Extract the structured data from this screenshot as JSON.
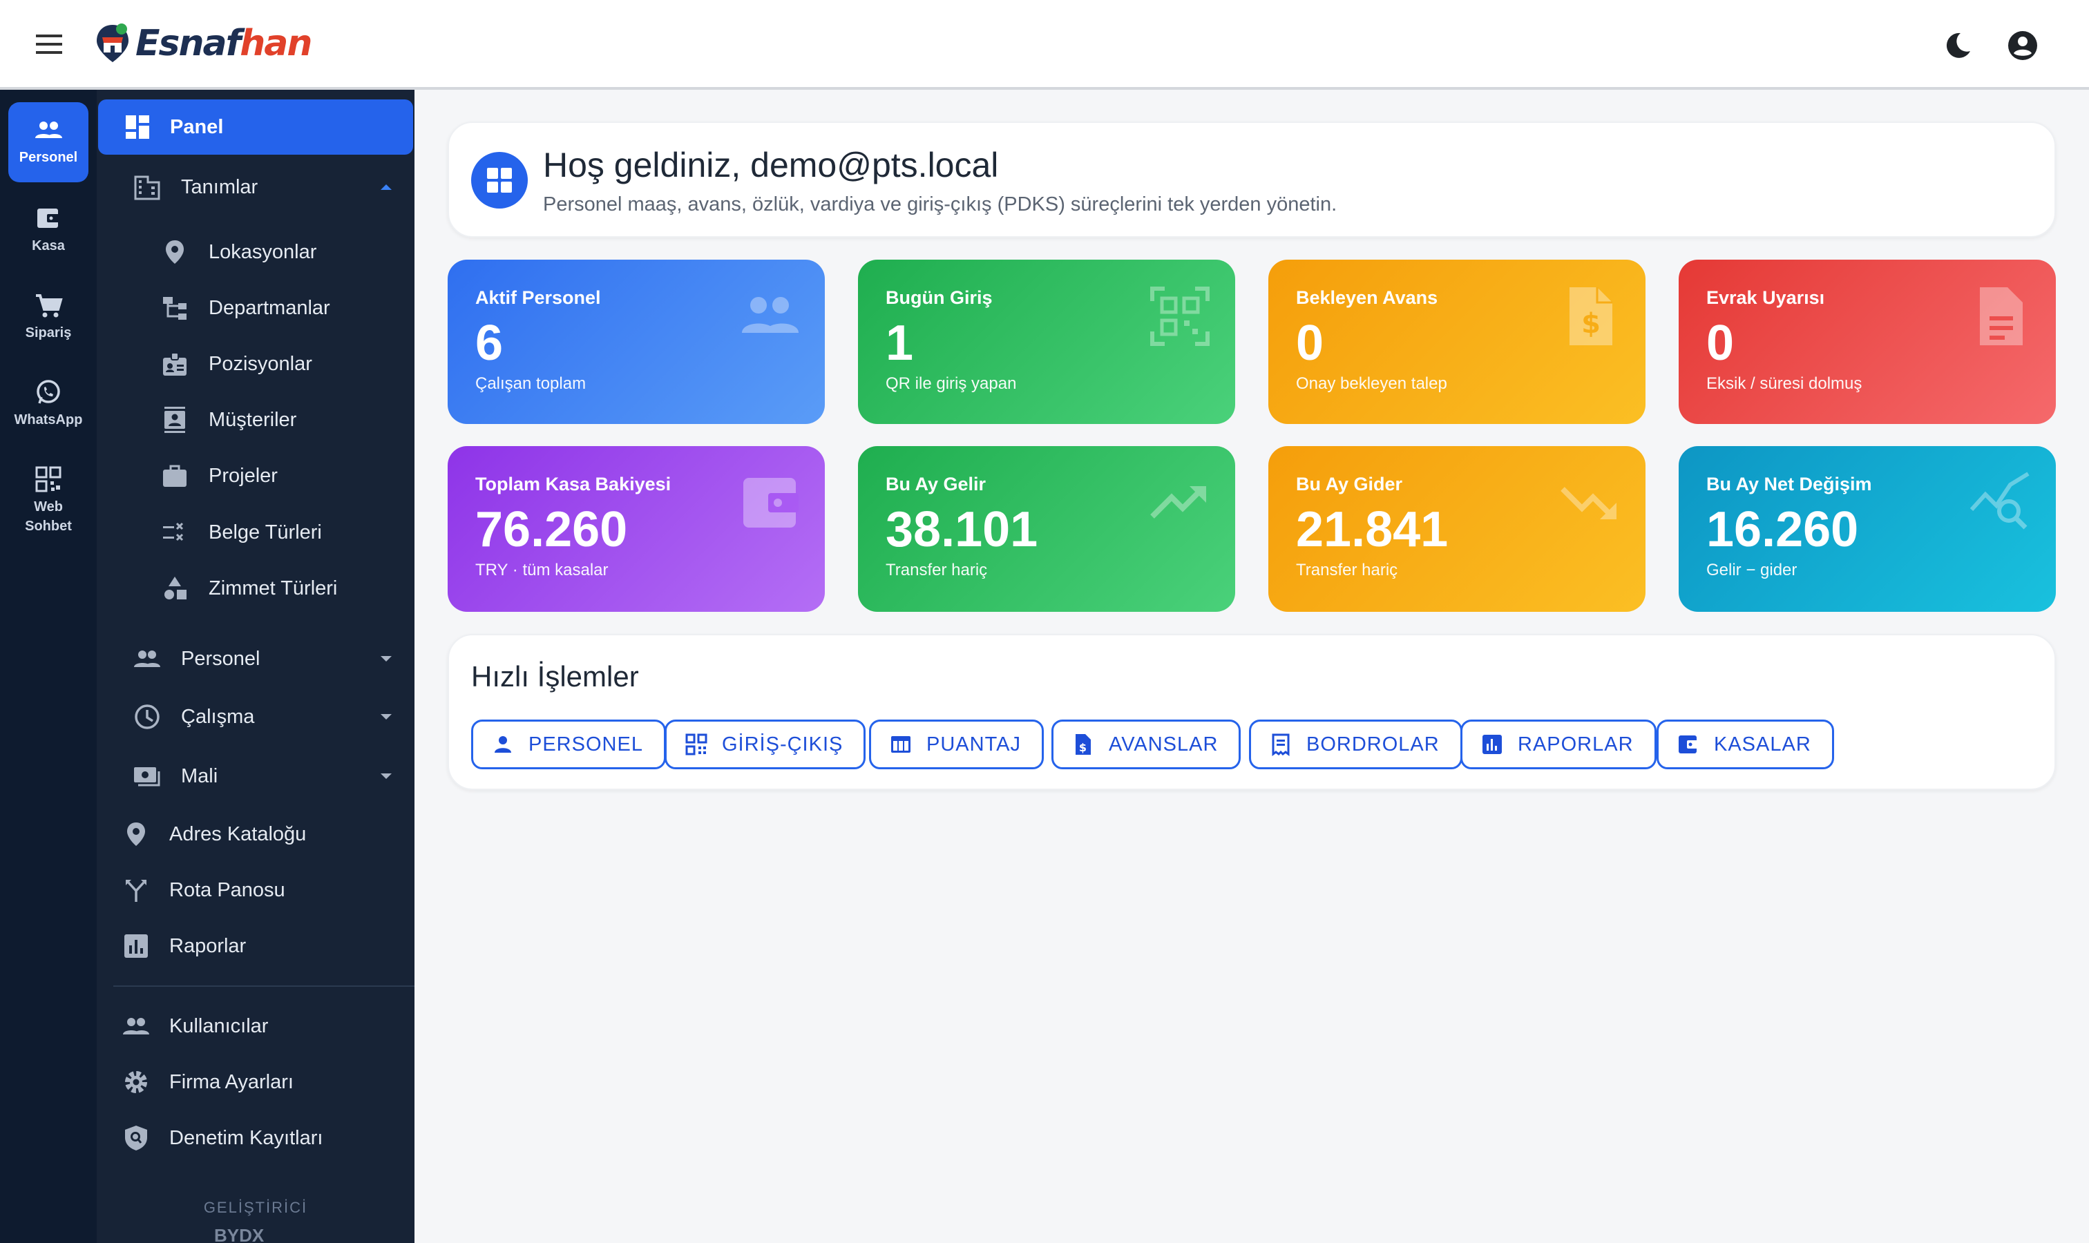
{
  "brand": {
    "name_part1": "Esnaf",
    "name_part2": "han",
    "icon": "store-pin-logo"
  },
  "topbar": {
    "menu_icon": "hamburger-icon",
    "theme_icon": "moon-icon",
    "account_icon": "account-circle-icon"
  },
  "rail": {
    "items": [
      {
        "label": "Personel",
        "icon": "people-icon",
        "active": true
      },
      {
        "label": "Kasa",
        "icon": "wallet-icon"
      },
      {
        "label": "Sipariş",
        "icon": "cart-icon"
      },
      {
        "label": "WhatsApp",
        "icon": "whatsapp-icon"
      },
      {
        "label": "Web Sohbet",
        "icon": "qr-chat-icon"
      }
    ]
  },
  "sidebar": {
    "panel": "Panel",
    "tanimlar": "Tanımlar",
    "sub_items": [
      "Lokasyonlar",
      "Departmanlar",
      "Pozisyonlar",
      "Müşteriler",
      "Projeler",
      "Belge Türleri",
      "Zimmet Türleri"
    ],
    "groups": [
      "Personel",
      "Çalışma",
      "Mali"
    ],
    "links": [
      "Adres Kataloğu",
      "Rota Panosu",
      "Raporlar"
    ],
    "admin": [
      "Kullanıcılar",
      "Firma Ayarları",
      "Denetim Kayıtları"
    ],
    "developer_label": "GELİŞTİRİCİ",
    "developer_logo": "BYDX"
  },
  "welcome": {
    "title": "Hoş geldiniz, demo@pts.local",
    "subtitle": "Personel maaş, avans, özlük, vardiya ve giriş-çıkış (PDKS) süreçlerini tek yerden yönetin."
  },
  "stats": [
    {
      "title": "Aktif Personel",
      "value": "6",
      "sub": "Çalışan toplam",
      "icon": "people-icon",
      "color": "#3b82f6"
    },
    {
      "title": "Bugün Giriş",
      "value": "1",
      "sub": "QR ile giriş yapan",
      "icon": "qr-code-icon",
      "color": "#22c55e"
    },
    {
      "title": "Bekleyen Avans",
      "value": "0",
      "sub": "Onay bekleyen talep",
      "icon": "money-file-icon",
      "color": "#f59e0b"
    },
    {
      "title": "Evrak Uyarısı",
      "value": "0",
      "sub": "Eksik / süresi dolmuş",
      "icon": "document-icon",
      "color": "#ef4444"
    },
    {
      "title": "Toplam Kasa Bakiyesi",
      "value": "76.260",
      "sub": "TRY · tüm kasalar",
      "icon": "wallet-icon",
      "color": "#a855f7"
    },
    {
      "title": "Bu Ay Gelir",
      "value": "38.101",
      "sub": "Transfer hariç",
      "icon": "trending-up-icon",
      "color": "#22c55e"
    },
    {
      "title": "Bu Ay Gider",
      "value": "21.841",
      "sub": "Transfer hariç",
      "icon": "trending-down-icon",
      "color": "#f59e0b"
    },
    {
      "title": "Bu Ay Net Değişim",
      "value": "16.260",
      "sub": "Gelir − gider",
      "icon": "query-stats-icon",
      "color": "#06b6d4"
    }
  ],
  "quick": {
    "title": "Hızlı İşlemler",
    "buttons": [
      "PERSONEL",
      "GİRİŞ-ÇIKIŞ",
      "PUANTAJ",
      "AVANSLAR",
      "BORDROLAR",
      "RAPORLAR",
      "KASALAR"
    ]
  }
}
